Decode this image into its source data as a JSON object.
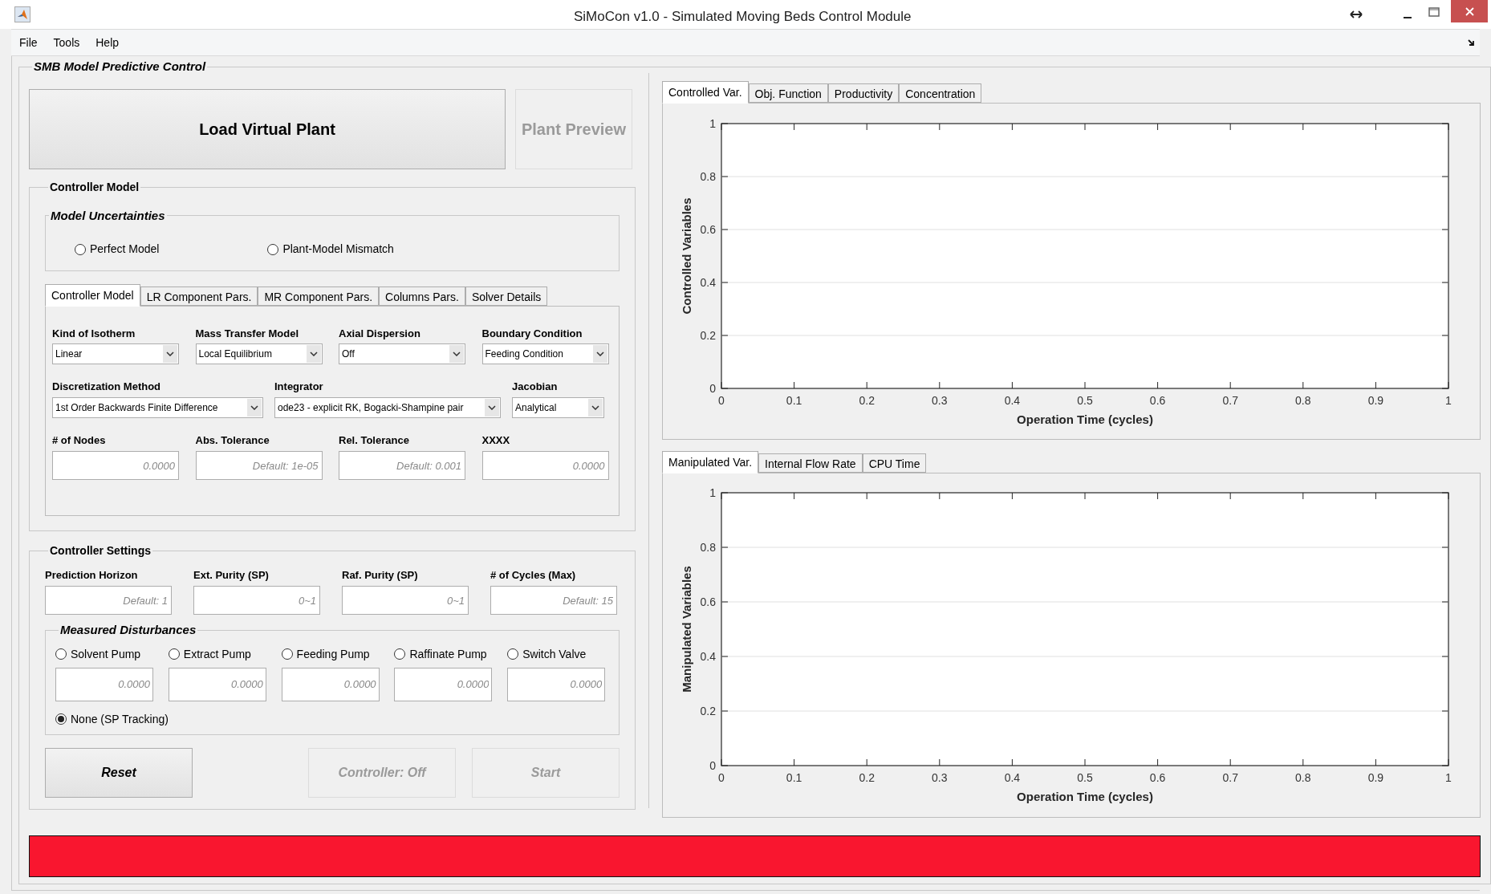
{
  "window": {
    "title": "SiMoCon v1.0 - Simulated Moving Beds Control Module"
  },
  "menu": [
    "File",
    "Tools",
    "Help"
  ],
  "panel": {
    "title": "SMB Model Predictive Control"
  },
  "plant_buttons": [
    {
      "label": "Load Virtual Plant",
      "disabled": false
    },
    {
      "label": "Plant Preview",
      "disabled": true
    }
  ],
  "controller_model": {
    "title": "Controller Model",
    "uncertainties": {
      "title": "Model Uncertainties",
      "options": [
        {
          "label": "Perfect Model",
          "selected": false
        },
        {
          "label": "Plant-Model Mismatch",
          "selected": false
        }
      ]
    },
    "tabs": [
      {
        "label": "Controller Model",
        "selected": true
      },
      {
        "label": "LR Component Pars.",
        "selected": false
      },
      {
        "label": "MR Component Pars.",
        "selected": false
      },
      {
        "label": "Columns Pars.",
        "selected": false
      },
      {
        "label": "Solver Details",
        "selected": false
      }
    ],
    "dropdown_rows": [
      [
        {
          "label": "Kind of Isotherm",
          "value": "Linear"
        },
        {
          "label": "Mass Transfer Model",
          "value": "Local Equilibrium"
        },
        {
          "label": "Axial Dispersion",
          "value": "Off"
        },
        {
          "label": "Boundary Condition",
          "value": "Feeding Condition"
        }
      ],
      [
        {
          "label": "Discretization Method",
          "value": "1st Order Backwards Finite Difference"
        },
        {
          "label": "Integrator",
          "value": "ode23 - explicit RK, Bogacki-Shampine pair"
        },
        {
          "label": "Jacobian",
          "value": "Analytical"
        }
      ]
    ],
    "fields": [
      {
        "label": "# of Nodes",
        "placeholder": "0.0000"
      },
      {
        "label": "Abs. Tolerance",
        "placeholder": "Default: 1e-05"
      },
      {
        "label": "Rel. Tolerance",
        "placeholder": "Default: 0.001"
      },
      {
        "label": "XXXX",
        "placeholder": "0.0000"
      }
    ]
  },
  "controller_settings": {
    "title": "Controller Settings",
    "fields": [
      {
        "label": "Prediction Horizon",
        "placeholder": "Default: 1"
      },
      {
        "label": "Ext. Purity (SP)",
        "placeholder": "0~1"
      },
      {
        "label": "Raf. Purity (SP)",
        "placeholder": "0~1"
      },
      {
        "label": "# of Cycles (Max)",
        "placeholder": "Default: 15"
      }
    ],
    "disturbances": {
      "title": "Measured Disturbances",
      "options": [
        {
          "label": "Solvent Pump",
          "selected": false,
          "placeholder": "0.0000"
        },
        {
          "label": "Extract Pump",
          "selected": false,
          "placeholder": "0.0000"
        },
        {
          "label": "Feeding Pump",
          "selected": false,
          "placeholder": "0.0000"
        },
        {
          "label": "Raffinate Pump",
          "selected": false,
          "placeholder": "0.0000"
        },
        {
          "label": "Switch Valve",
          "selected": false,
          "placeholder": "0.0000"
        }
      ],
      "none_option": {
        "label": "None (SP Tracking)",
        "selected": true
      }
    },
    "actions": [
      {
        "label": "Reset",
        "disabled": false
      },
      {
        "label": "Controller: Off",
        "disabled": true
      },
      {
        "label": "Start",
        "disabled": true
      }
    ]
  },
  "top_plot": {
    "tabs": [
      {
        "label": "Controlled Var.",
        "selected": true
      },
      {
        "label": "Obj. Function",
        "selected": false
      },
      {
        "label": "Productivity",
        "selected": false
      },
      {
        "label": "Concentration",
        "selected": false
      }
    ],
    "chart_data": {
      "type": "line",
      "grid": true,
      "xlabel": "Operation Time (cycles)",
      "ylabel": "Controlled Variables",
      "xlim": [
        0,
        1
      ],
      "ylim": [
        0,
        1
      ],
      "xticks": [
        0,
        0.1,
        0.2,
        0.3,
        0.4,
        0.5,
        0.6,
        0.7,
        0.8,
        0.9,
        1
      ],
      "yticks": [
        0,
        0.2,
        0.4,
        0.6,
        0.8,
        1
      ]
    }
  },
  "bottom_plot": {
    "tabs": [
      {
        "label": "Manipulated Var.",
        "selected": true
      },
      {
        "label": "Internal Flow Rate",
        "selected": false
      },
      {
        "label": "CPU Time",
        "selected": false
      }
    ],
    "chart_data": {
      "type": "line",
      "grid": true,
      "xlabel": "Operation Time (cycles)",
      "ylabel": "Manipulated Variables",
      "xlim": [
        0,
        1
      ],
      "ylim": [
        0,
        1
      ],
      "xticks": [
        0,
        0.1,
        0.2,
        0.3,
        0.4,
        0.5,
        0.6,
        0.7,
        0.8,
        0.9,
        1
      ],
      "yticks": [
        0,
        0.2,
        0.4,
        0.6,
        0.8,
        1
      ]
    }
  }
}
